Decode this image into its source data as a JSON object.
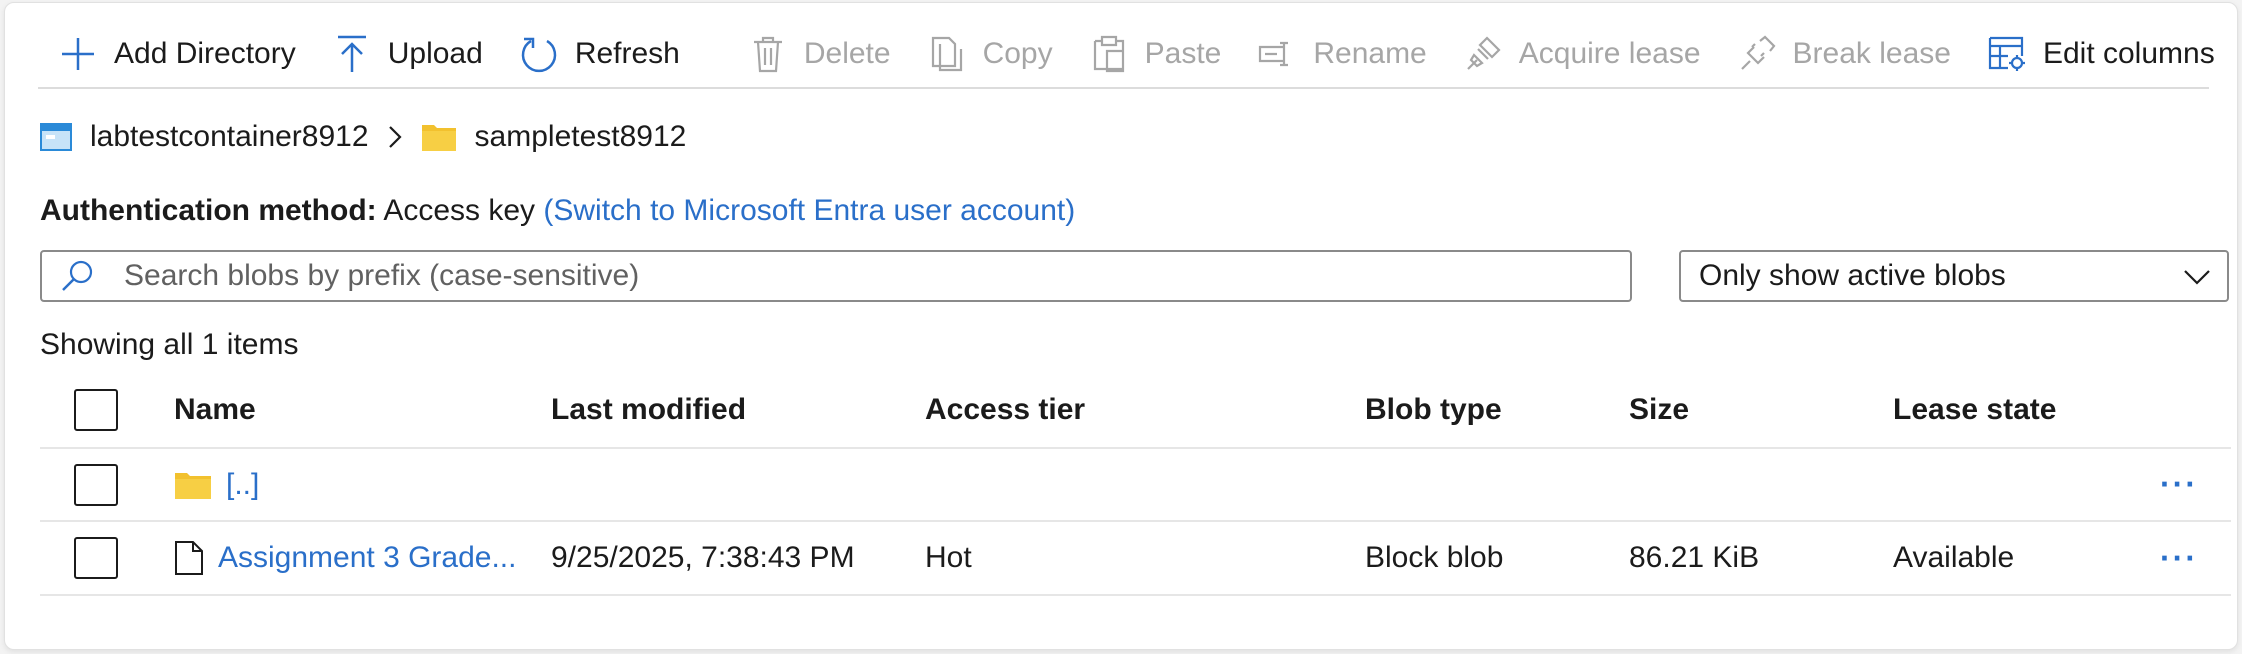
{
  "toolbar": {
    "add_directory": "Add Directory",
    "upload": "Upload",
    "refresh": "Refresh",
    "delete": "Delete",
    "copy": "Copy",
    "paste": "Paste",
    "rename": "Rename",
    "acquire_lease": "Acquire lease",
    "break_lease": "Break lease",
    "edit_columns": "Edit columns"
  },
  "breadcrumb": {
    "container": "labtestcontainer8912",
    "folder": "sampletest8912"
  },
  "auth": {
    "label": "Authentication method:",
    "value": "Access key",
    "switch_link": "(Switch to Microsoft Entra user account)"
  },
  "search": {
    "placeholder": "Search blobs by prefix (case-sensitive)",
    "value": ""
  },
  "filter": {
    "selected": "Only show active blobs"
  },
  "showing_text": "Showing all 1 items",
  "table": {
    "columns": [
      "Name",
      "Last modified",
      "Access tier",
      "Blob type",
      "Size",
      "Lease state"
    ],
    "rows": [
      {
        "name": "[..]",
        "modified": "",
        "tier": "",
        "type": "",
        "size": "",
        "lease": "",
        "more": "···"
      },
      {
        "name": "Assignment 3 Grade...",
        "modified": "9/25/2025, 7:38:43 PM",
        "tier": "Hot",
        "type": "Block blob",
        "size": "86.21 KiB",
        "lease": "Available",
        "more": "···"
      }
    ]
  },
  "colors": {
    "accent": "#2a6fc9",
    "folder": "#f2c12e",
    "disabled": "#a6a6a6"
  }
}
